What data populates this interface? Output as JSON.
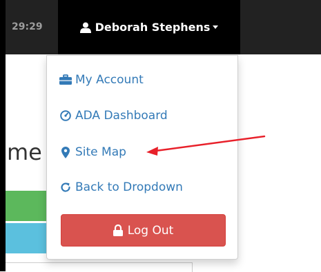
{
  "navbar": {
    "timer": "29:29",
    "user_name": "Deborah Stephens",
    "user_icon": "user-icon",
    "caret_icon": "caret-down-icon"
  },
  "page": {
    "partial_text": "me"
  },
  "dropdown": {
    "items": [
      {
        "label": "My Account",
        "icon": "briefcase-icon"
      },
      {
        "label": "ADA Dashboard",
        "icon": "dashboard-icon"
      },
      {
        "label": "Site Map",
        "icon": "map-marker-icon"
      },
      {
        "label": "Back to Dropdown",
        "icon": "refresh-icon"
      }
    ],
    "logout_label": "Log Out",
    "logout_icon": "lock-icon"
  },
  "colors": {
    "navbar_bg": "#222222",
    "user_bg": "#000000",
    "link": "#337ab7",
    "danger": "#d9534f",
    "success": "#5cb85c",
    "info": "#5bc0de",
    "annotation": "#e8202a"
  }
}
